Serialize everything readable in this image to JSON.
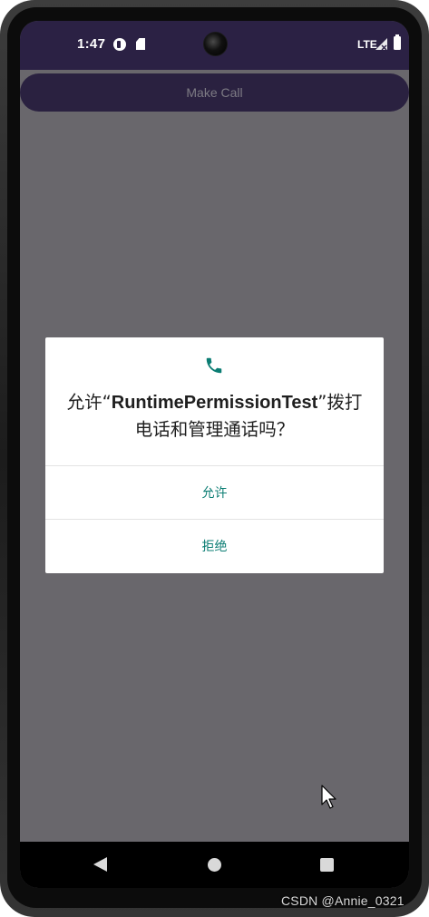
{
  "status_bar": {
    "time": "1:47",
    "network": "LTE",
    "icons": [
      "app-notification-icon",
      "sd-card-icon",
      "signal-icon",
      "battery-icon"
    ]
  },
  "app": {
    "make_call_label": "Make Call"
  },
  "dialog": {
    "icon": "phone-icon",
    "message_prefix": "允许“",
    "app_name": "RuntimePermissionTest",
    "message_suffix": "”拨打电话和管理通话吗？",
    "allow_label": "允许",
    "deny_label": "拒绝"
  },
  "nav_bar": {
    "icons": [
      "back-icon",
      "home-icon",
      "recents-icon"
    ]
  },
  "watermark": "CSDN @Annie_0321",
  "colors": {
    "status_bar": "#2b2144",
    "scrim": "#69676c",
    "button": "#2a2140",
    "accent": "#0b7d73"
  }
}
